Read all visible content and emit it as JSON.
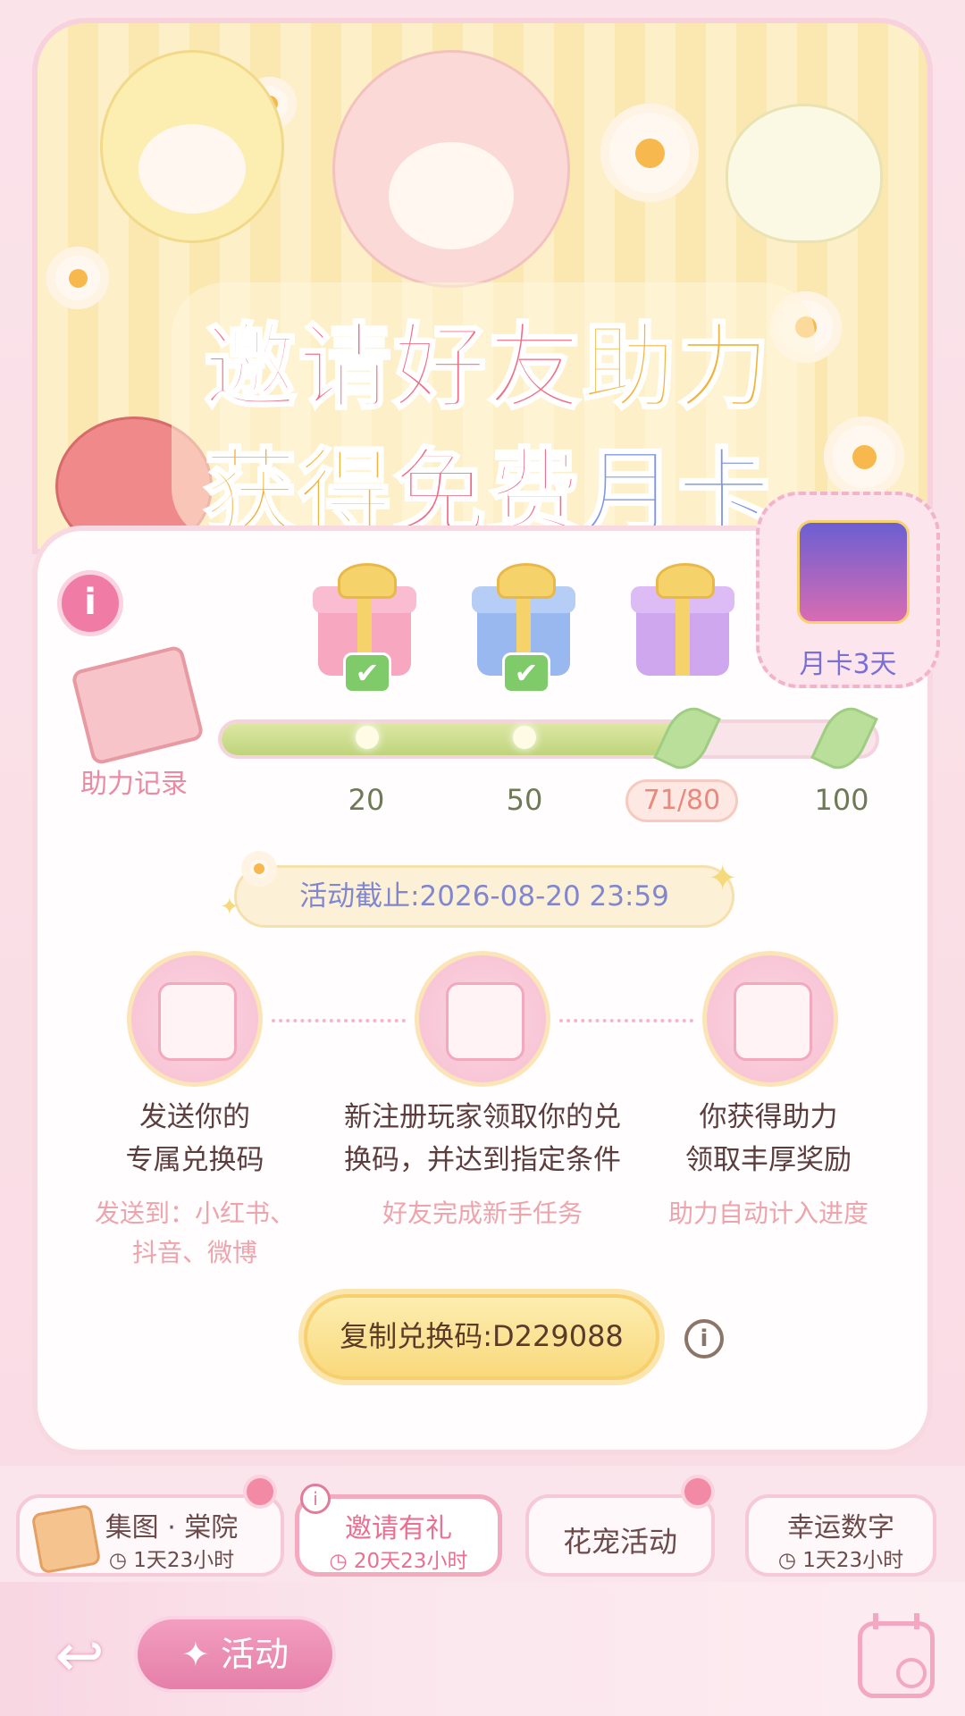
{
  "banner": {
    "title_line1": [
      {
        "text": "邀请好友",
        "color": "#ef6f86"
      },
      {
        "text": "助力",
        "color": "#f2b43c"
      }
    ],
    "title_line2": [
      {
        "text": "获得",
        "color": "#f2b43c"
      },
      {
        "text": "免费",
        "color": "#ef6f86"
      },
      {
        "text": "月卡",
        "color": "#7f96e6"
      }
    ]
  },
  "progress": {
    "info_icon": "i",
    "history_label": "助力记录",
    "current": 71,
    "max": 100,
    "fill_ratio": 0.71,
    "milestones": [
      {
        "label": "20",
        "claimed": true,
        "gift": "pink-gift"
      },
      {
        "label": "50",
        "claimed": true,
        "gift": "blue-gift"
      },
      {
        "label": "71/80",
        "claimed": false,
        "gift": "purple-gift",
        "current": true
      },
      {
        "label": "100",
        "claimed": false,
        "gift": "monthly-card-box"
      }
    ],
    "final_reward_label": "月卡3天",
    "check_glyph": "✔"
  },
  "deadline": {
    "text": "活动截止:2026-08-20 23:59"
  },
  "steps": [
    {
      "icon": "gift-code-icon",
      "title": "发送你的\n专属兑换码",
      "sub": "发送到：小红书、\n抖音、微博"
    },
    {
      "icon": "clipboard-icon",
      "title": "新注册玩家领取你的兑\n换码，并达到指定条件",
      "sub": "好友完成新手任务"
    },
    {
      "icon": "gift-box-icon",
      "title": "你获得助力\n领取丰厚奖励",
      "sub": "助力自动计入进度"
    }
  ],
  "copy": {
    "button_label": "复制兑换码:D229088",
    "info_icon": "i"
  },
  "tabs": [
    {
      "title": "集图 · 棠院",
      "time": "◷ 1天23小时",
      "active": false
    },
    {
      "title": "邀请有礼",
      "time": "◷ 20天23小时",
      "active": true
    },
    {
      "title": "花宠活动",
      "time": "",
      "active": false
    },
    {
      "title": "幸运数字",
      "time": "◷ 1天23小时",
      "active": false
    }
  ],
  "footer": {
    "back_icon": "↩",
    "activity_label": "✦ 活动",
    "calendar_icon": "calendar-icon"
  },
  "colors": {
    "accent_pink": "#ef6f86",
    "accent_yellow": "#f2b43c",
    "accent_blue": "#7f96e6",
    "progress_green": "#bfd47c"
  }
}
